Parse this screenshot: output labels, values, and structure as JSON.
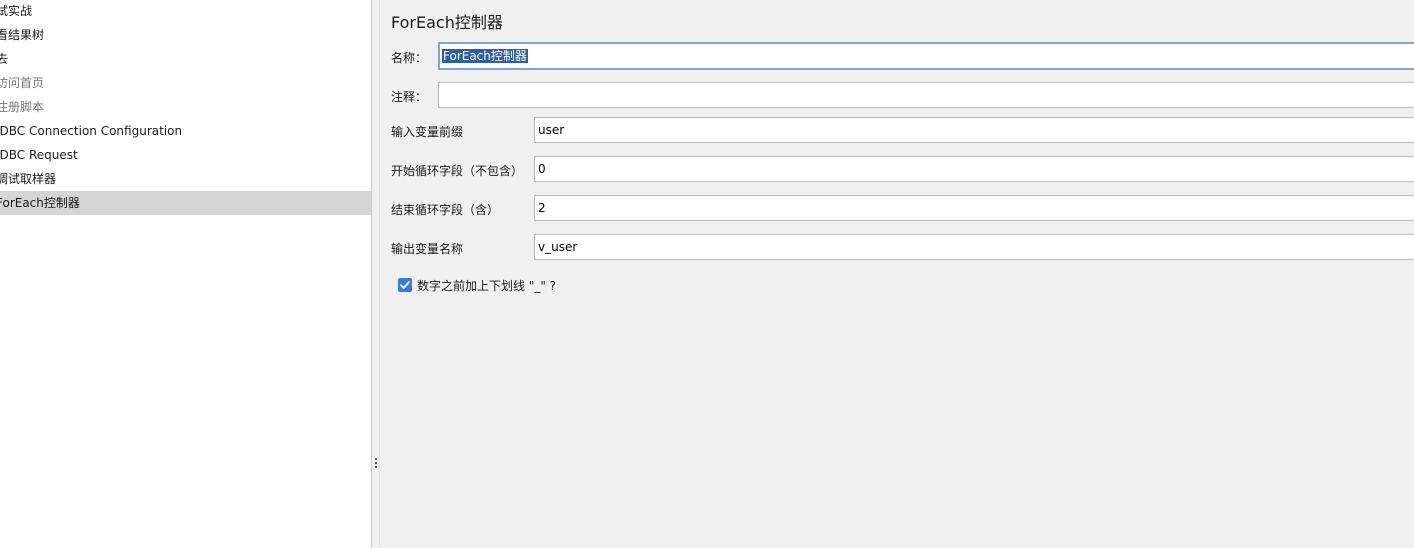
{
  "tree": {
    "items": [
      {
        "label": "试实战",
        "state": "normal"
      },
      {
        "label": "看结果树",
        "state": "normal"
      },
      {
        "label": "去",
        "state": "normal"
      },
      {
        "label": "访问首页",
        "state": "disabled"
      },
      {
        "label": "注册脚本",
        "state": "disabled"
      },
      {
        "label": "JDBC Connection Configuration",
        "state": "normal"
      },
      {
        "label": "JDBC Request",
        "state": "normal"
      },
      {
        "label": "调试取样器",
        "state": "normal"
      },
      {
        "label": "ForEach控制器",
        "state": "selected"
      }
    ]
  },
  "panel": {
    "title": "ForEach控制器",
    "name_label": "名称：",
    "name_value": "ForEach控制器",
    "comment_label": "注释：",
    "comment_value": "",
    "input_prefix_label": "输入变量前缀",
    "input_prefix_value": "user",
    "start_index_label": "开始循环字段（不包含）",
    "start_index_value": "0",
    "end_index_label": "结束循环字段（含）",
    "end_index_value": "2",
    "output_var_label": "输出变量名称",
    "output_var_value": "v_user",
    "underscore_label": "数字之前加上下划线 \"_\" ?",
    "underscore_checked": true
  },
  "colors": {
    "panel_bg": "#f0f0f0",
    "selected_row": "#d5d5d5",
    "checkbox": "#3a7bd5",
    "focus_border": "#7ea6d6",
    "text_selection": "#2e5f9e"
  }
}
